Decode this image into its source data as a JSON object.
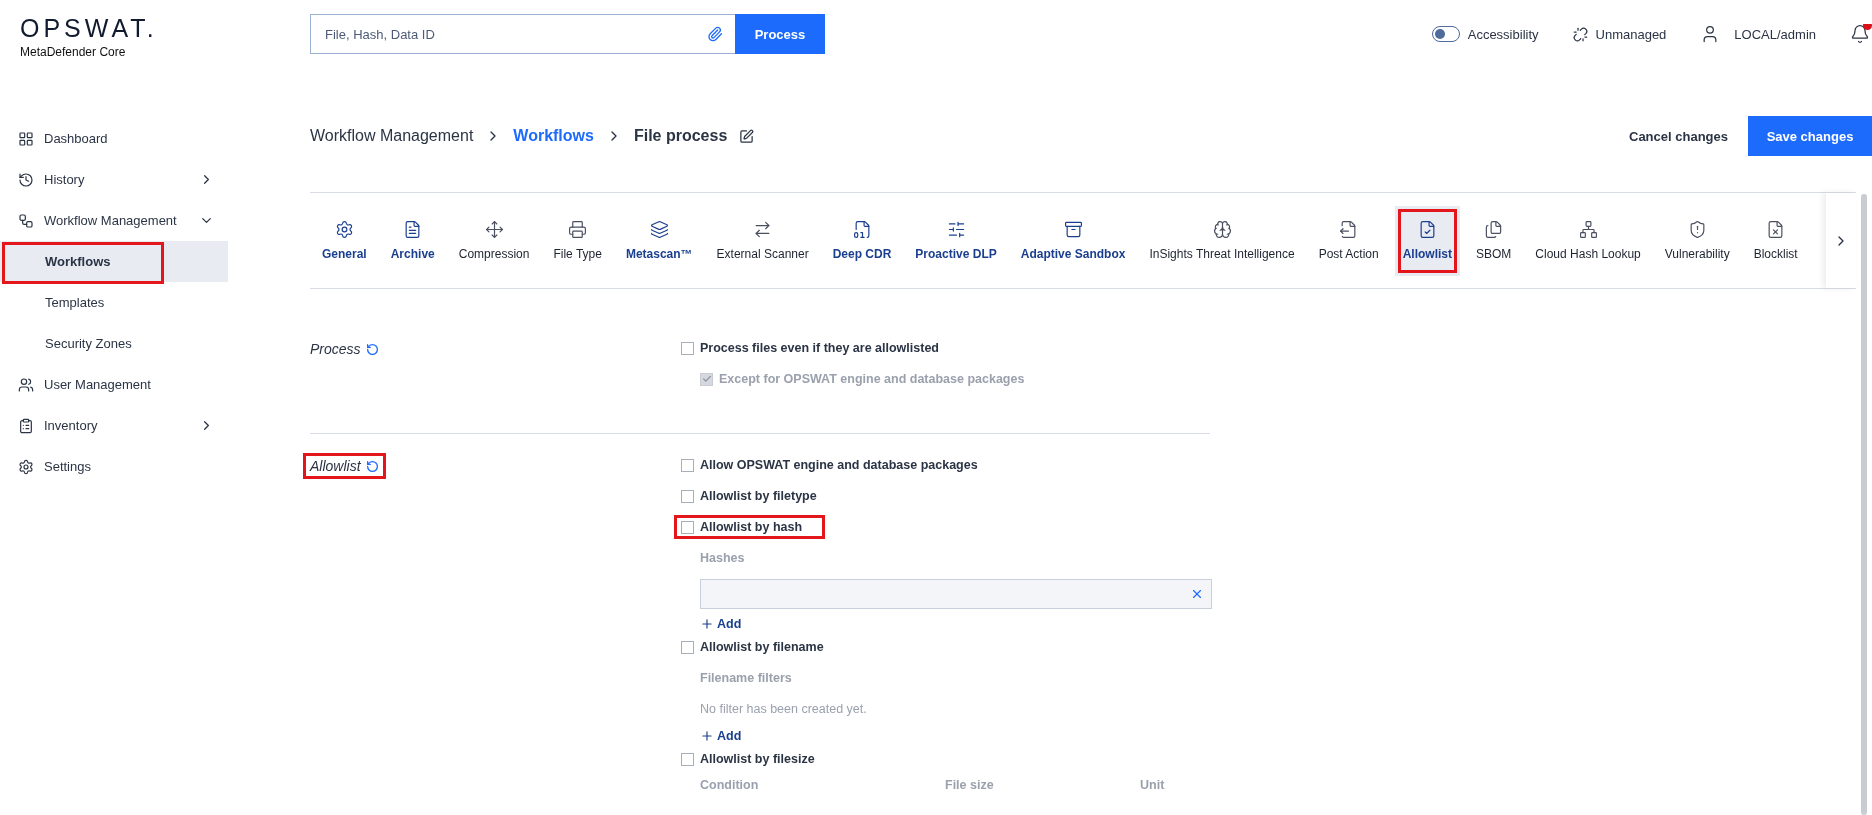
{
  "header": {
    "logo": "OPSWAT.",
    "product": "MetaDefender Core",
    "search": {
      "placeholder": "File, Hash, Data ID"
    },
    "process_button": "Process",
    "accessibility": {
      "label": "Accessibility",
      "on": false
    },
    "unmanaged": "Unmanaged",
    "user": "LOCAL/admin",
    "notifications": {
      "unread": true
    }
  },
  "sidebar": {
    "items": [
      {
        "label": "Dashboard",
        "selected": false
      },
      {
        "label": "History",
        "selected": false,
        "expanded": false
      },
      {
        "label": "Workflow Management",
        "selected": false,
        "expanded": true,
        "children": [
          {
            "label": "Workflows",
            "selected": true,
            "highlighted": true
          },
          {
            "label": "Templates",
            "selected": false,
            "highlighted": false
          },
          {
            "label": "Security Zones",
            "selected": false,
            "highlighted": false
          }
        ]
      },
      {
        "label": "User Management",
        "selected": false
      },
      {
        "label": "Inventory",
        "selected": false,
        "expanded": false
      },
      {
        "label": "Settings",
        "selected": false
      }
    ]
  },
  "breadcrumb": [
    {
      "label": "Workflow Management",
      "kind": "plain"
    },
    {
      "label": "Workflows",
      "kind": "link"
    },
    {
      "label": "File process",
      "kind": "current"
    }
  ],
  "actions": {
    "cancel": "Cancel changes",
    "save": "Save changes"
  },
  "tabs": [
    {
      "label": "General",
      "configured": true,
      "selected": false
    },
    {
      "label": "Archive",
      "configured": true,
      "selected": false
    },
    {
      "label": "Compression",
      "configured": false,
      "selected": false
    },
    {
      "label": "File Type",
      "configured": false,
      "selected": false
    },
    {
      "label": "Metascan™",
      "configured": true,
      "selected": false
    },
    {
      "label": "External Scanner",
      "configured": false,
      "selected": false
    },
    {
      "label": "Deep CDR",
      "configured": true,
      "selected": false
    },
    {
      "label": "Proactive DLP",
      "configured": true,
      "selected": false
    },
    {
      "label": "Adaptive Sandbox",
      "configured": true,
      "selected": false
    },
    {
      "label": "InSights Threat Intelligence",
      "configured": false,
      "selected": false
    },
    {
      "label": "Post Action",
      "configured": false,
      "selected": false
    },
    {
      "label": "Allowlist",
      "configured": true,
      "selected": true,
      "highlighted": true
    },
    {
      "label": "SBOM",
      "configured": false,
      "selected": false
    },
    {
      "label": "Cloud Hash Lookup",
      "configured": false,
      "selected": false
    },
    {
      "label": "Vulnerability",
      "configured": false,
      "selected": false
    },
    {
      "label": "Blocklist",
      "configured": false,
      "selected": false
    }
  ],
  "sections": [
    {
      "title": "Process",
      "highlighted": false,
      "options": [
        {
          "kind": "checkbox",
          "label": "Process files even if they are allowlisted",
          "checked": false,
          "disabled": false,
          "highlighted": false,
          "children": [
            {
              "kind": "checkbox",
              "label": "Except for OPSWAT engine and database packages",
              "checked": true,
              "disabled": true,
              "highlighted": false
            }
          ]
        }
      ]
    },
    {
      "title": "Allowlist",
      "highlighted": true,
      "options": [
        {
          "kind": "checkbox",
          "label": "Allow OPSWAT engine and database packages",
          "checked": false,
          "disabled": false,
          "highlighted": false
        },
        {
          "kind": "checkbox",
          "label": "Allowlist by filetype",
          "checked": false,
          "disabled": false,
          "highlighted": false
        },
        {
          "kind": "checkbox",
          "label": "Allowlist by hash",
          "checked": false,
          "disabled": false,
          "highlighted": true,
          "children": [
            {
              "kind": "caption",
              "label": "Hashes"
            },
            {
              "kind": "field"
            },
            {
              "kind": "add",
              "label": "Add"
            }
          ]
        },
        {
          "kind": "checkbox",
          "label": "Allowlist by filename",
          "checked": false,
          "disabled": false,
          "highlighted": false,
          "children": [
            {
              "kind": "caption",
              "label": "Filename filters"
            },
            {
              "kind": "note",
              "label": "No filter has been created yet."
            },
            {
              "kind": "add",
              "label": "Add"
            }
          ]
        },
        {
          "kind": "checkbox",
          "label": "Allowlist by filesize",
          "checked": false,
          "disabled": false,
          "highlighted": false,
          "children": [
            {
              "kind": "columns",
              "columns": [
                "Condition",
                "File size",
                "Unit"
              ]
            }
          ]
        }
      ]
    }
  ]
}
